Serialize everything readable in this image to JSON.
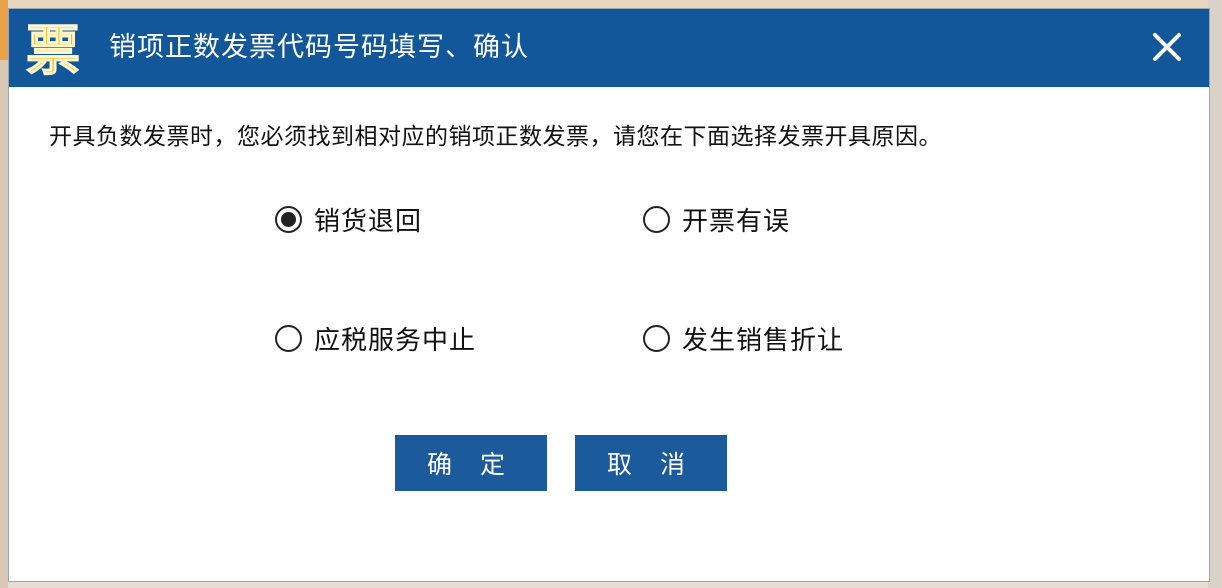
{
  "dialog": {
    "logo_glyph": "票",
    "title": "销项正数发票代码号码填写、确认",
    "close_icon": "close-icon",
    "instruction": "开具负数发票时，您必须找到相对应的销项正数发票，请您在下面选择发票开具原因。",
    "options": [
      {
        "label": "销货退回",
        "checked": true
      },
      {
        "label": "开票有误",
        "checked": false
      },
      {
        "label": "应税服务中止",
        "checked": false
      },
      {
        "label": "发生销售折让",
        "checked": false
      }
    ],
    "buttons": {
      "confirm": "确 定",
      "cancel": "取 消"
    },
    "colors": {
      "titlebar": "#12579a",
      "button": "#1b5a9b",
      "logo_text": "#f2b807"
    }
  }
}
